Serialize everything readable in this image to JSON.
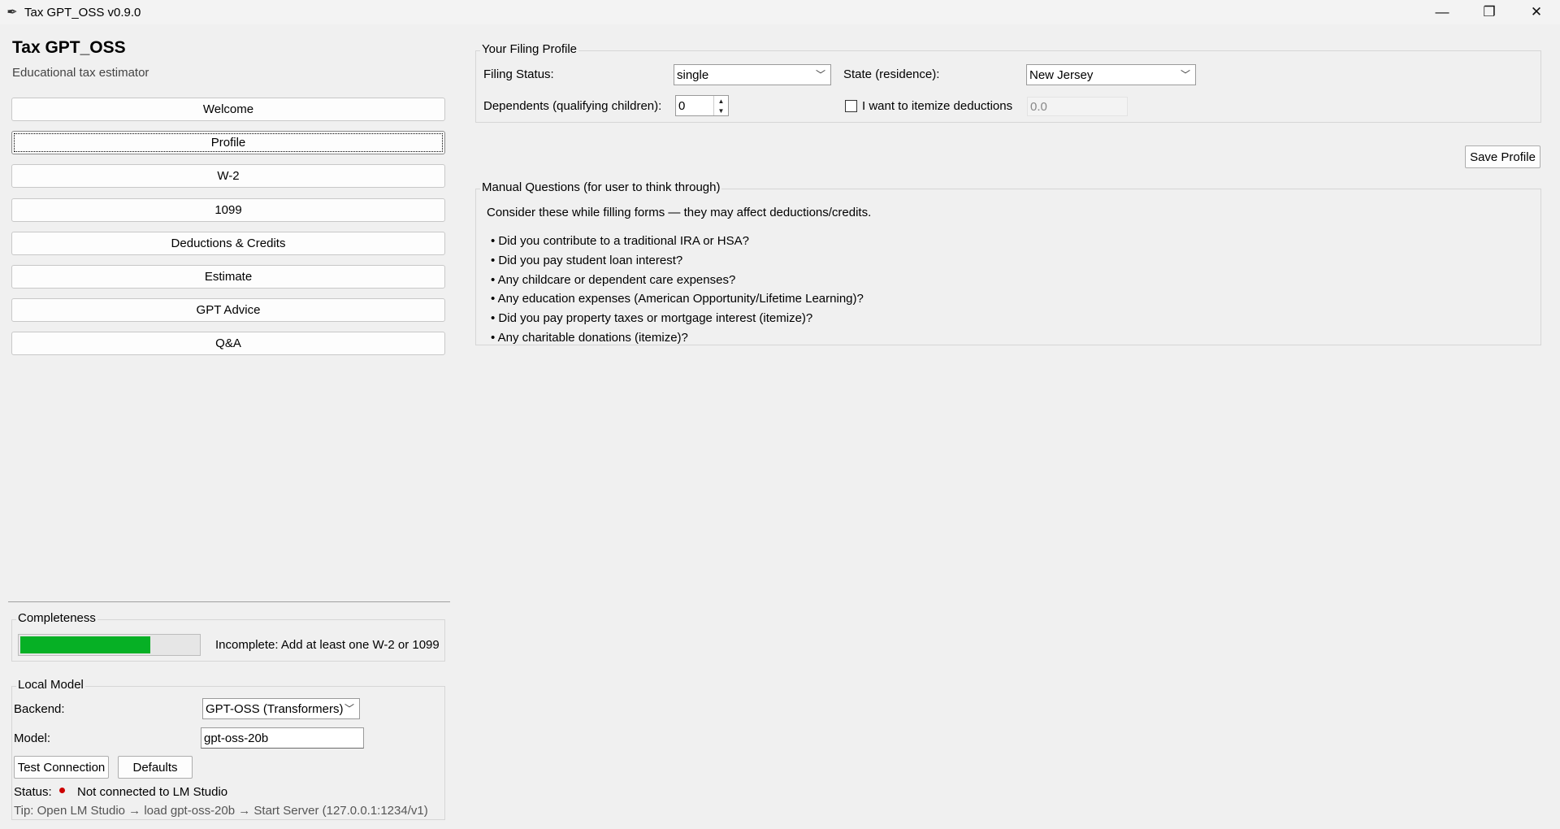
{
  "window": {
    "title": "Tax GPT_OSS v0.9.0",
    "app_icon": "feather-icon",
    "controls": {
      "minimize": "—",
      "maximize": "❐",
      "close": "✕"
    }
  },
  "sidebar": {
    "app_title": "Tax GPT_OSS",
    "subtitle": "Educational tax estimator",
    "active_item": "Profile",
    "items": [
      {
        "label": "Welcome"
      },
      {
        "label": "Profile"
      },
      {
        "label": "W-2"
      },
      {
        "label": "1099"
      },
      {
        "label": "Deductions & Credits"
      },
      {
        "label": "Estimate"
      },
      {
        "label": "GPT Advice"
      },
      {
        "label": "Q&A"
      }
    ]
  },
  "completeness": {
    "title": "Completeness",
    "progress_fraction": 0.73,
    "progress_color": "#06b025",
    "message": "Incomplete: Add at least one W-2 or 1099"
  },
  "local_model": {
    "title": "Local Model",
    "backend_label": "Backend:",
    "backend_value": "GPT-OSS (Transformers)",
    "model_label": "Model:",
    "model_value": "gpt-oss-20b",
    "test_button": "Test Connection",
    "defaults_button": "Defaults",
    "status_label": "Status:",
    "status_text": "Not connected to LM Studio",
    "status_color": "#cc0000",
    "tip": "Tip: Open LM Studio → load gpt-oss-20b → Start Server (127.0.0.1:1234/v1)"
  },
  "profile": {
    "title": "Your Filing Profile",
    "filing_status_label": "Filing Status:",
    "filing_status_value": "single",
    "state_label": "State (residence):",
    "state_value": "New Jersey",
    "dependents_label": "Dependents (qualifying children):",
    "dependents_value": "0",
    "itemize_label": "I want to itemize deductions",
    "itemize_checked": false,
    "itemize_value": "0.0",
    "save_button": "Save Profile"
  },
  "manual_questions": {
    "title": "Manual Questions (for user to think through)",
    "intro": "Consider these while filling forms — they may affect deductions/credits.",
    "items": [
      "• Did you contribute to a traditional IRA or HSA?",
      "• Did you pay student loan interest?",
      "• Any childcare or dependent care expenses?",
      "• Any education expenses (American Opportunity/Lifetime Learning)?",
      "• Did you pay property taxes or mortgage interest (itemize)?",
      "• Any charitable donations (itemize)?"
    ]
  }
}
